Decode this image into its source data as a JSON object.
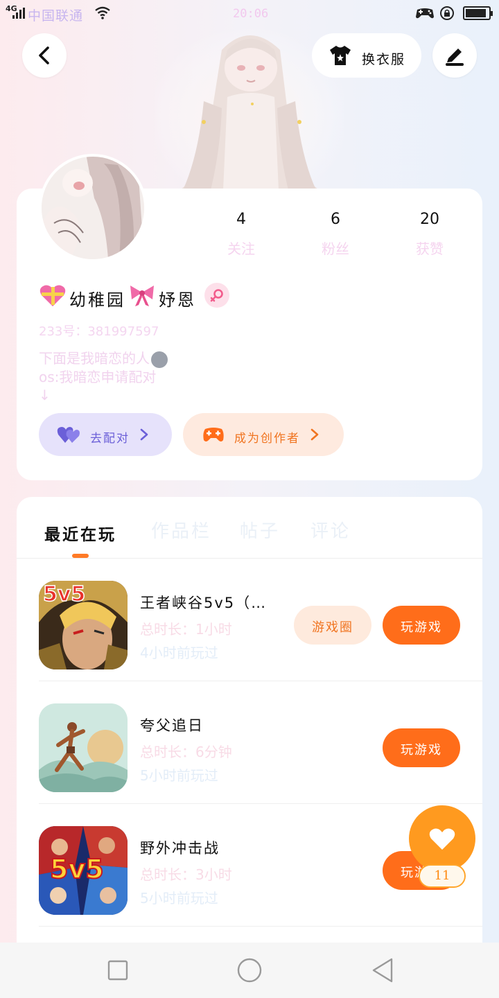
{
  "status_bar": {
    "network": "4G",
    "carrier": "中国联通",
    "time": "20:06",
    "battery_level": 0.92
  },
  "header": {
    "outfit_label": "换衣服"
  },
  "profile": {
    "stats": [
      {
        "value": "4",
        "label": "关注"
      },
      {
        "value": "6",
        "label": "粉丝"
      },
      {
        "value": "20",
        "label": "获赞"
      }
    ],
    "name": "幼稚园",
    "name_suffix": "妤恩",
    "uid": "233号：381997597",
    "bio_line1": "下面是我暗恋的人",
    "bio_line2": "os:我暗恋申请配对",
    "bio_line3": "↓",
    "pair_button": "去配对",
    "creator_button": "成为创作者"
  },
  "tabs": {
    "active": "最近在玩",
    "others": [
      "作品栏",
      "帖子",
      "评论"
    ]
  },
  "games": [
    {
      "name": "王者峡谷5v5（…",
      "duration": "总时长：1小时",
      "last_played": "4小时前玩过",
      "circle_label": "游戏圈",
      "play_label": "玩游戏",
      "icon_text": "5v5"
    },
    {
      "name": "夸父追日",
      "duration": "总时长：6分钟",
      "last_played": "5小时前玩过",
      "circle_label": "",
      "play_label": "玩游戏",
      "icon_text": ""
    },
    {
      "name": "野外冲击战",
      "duration": "总时长：3小时",
      "last_played": "5小时前玩过",
      "circle_label": "",
      "play_label": "玩游戏",
      "icon_text": "5v5"
    }
  ],
  "fab": {
    "count": "11"
  },
  "colors": {
    "accent": "#ff6d1a",
    "pair": "#6b5fd8",
    "fab": "#ff9a1f"
  }
}
